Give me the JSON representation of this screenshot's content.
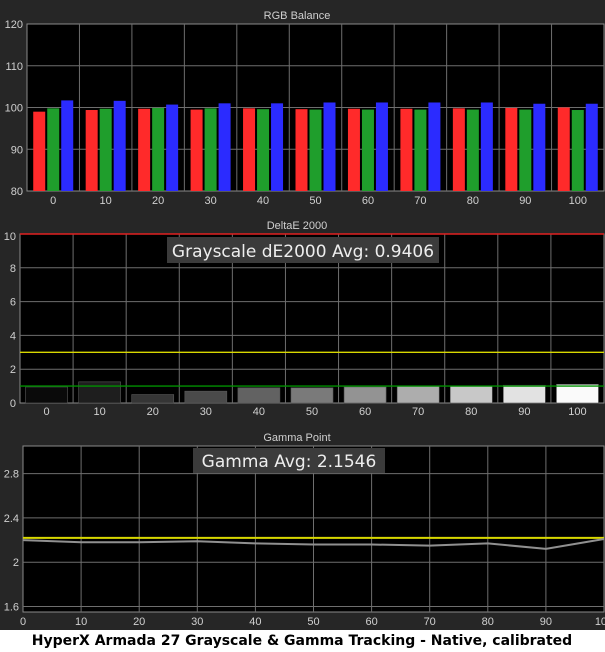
{
  "caption": "HyperX Armada 27 Grayscale & Gamma Tracking - Native, calibrated",
  "colors": {
    "background": "#262626",
    "plot": "#000000",
    "grid": "#6e6e6e",
    "text": "#d0d0d0",
    "red": "#ff2a2a",
    "green": "#1f9e2c",
    "blue": "#2b2bff",
    "yellow": "#d8d800",
    "limit_red": "#e02020",
    "limit_green": "#009000",
    "gamma_line": "#909090"
  },
  "chart_data": [
    {
      "type": "bar",
      "title": "RGB Balance",
      "categories": [
        "0",
        "10",
        "20",
        "30",
        "40",
        "50",
        "60",
        "70",
        "80",
        "90",
        "100"
      ],
      "ylim": [
        80,
        120
      ],
      "yticks": [
        80,
        90,
        100,
        110,
        120
      ],
      "grid": true,
      "series": [
        {
          "color": "red",
          "values": [
            99.0,
            99.4,
            99.7,
            99.5,
            99.8,
            99.6,
            99.7,
            99.7,
            99.8,
            99.9,
            100.0
          ]
        },
        {
          "color": "green",
          "values": [
            99.8,
            99.7,
            99.9,
            99.8,
            99.6,
            99.5,
            99.5,
            99.5,
            99.5,
            99.5,
            99.4
          ]
        },
        {
          "color": "blue",
          "values": [
            101.7,
            101.6,
            100.7,
            101.0,
            101.0,
            101.2,
            101.2,
            101.2,
            101.2,
            100.9,
            100.9
          ]
        }
      ]
    },
    {
      "type": "bar",
      "title": "DeltaE 2000",
      "annotation": "Grayscale dE2000 Avg: 0.9406",
      "categories": [
        "0",
        "10",
        "20",
        "30",
        "40",
        "50",
        "60",
        "70",
        "80",
        "90",
        "100"
      ],
      "values": [
        0.95,
        1.25,
        0.5,
        0.7,
        0.9,
        0.9,
        0.95,
        1.0,
        1.0,
        1.05,
        1.1
      ],
      "bar_colors": [
        "#0a0a0a",
        "#1e1e1e",
        "#353535",
        "#4a4a4a",
        "#626262",
        "#7a7a7a",
        "#939393",
        "#adadad",
        "#c8c8c8",
        "#e2e2e2",
        "#fafafa"
      ],
      "ylim": [
        0,
        10
      ],
      "yticks": [
        0,
        2,
        4,
        6,
        8,
        10
      ],
      "thresholds": [
        {
          "value": 10,
          "color": "limit_red"
        },
        {
          "value": 3,
          "color": "yellow"
        },
        {
          "value": 1,
          "color": "limit_green"
        }
      ],
      "grid": true
    },
    {
      "type": "line",
      "title": "Gamma Point",
      "annotation": "Gamma Avg: 2.1546",
      "x": [
        0,
        10,
        20,
        30,
        40,
        50,
        60,
        70,
        80,
        90,
        100
      ],
      "values": [
        2.2,
        2.18,
        2.18,
        2.19,
        2.17,
        2.16,
        2.16,
        2.15,
        2.17,
        2.12,
        2.21
      ],
      "target": 2.22,
      "xlim": [
        0,
        100
      ],
      "ylim": [
        1.55,
        3.05
      ],
      "yticks": [
        1.6,
        2.0,
        2.4,
        2.8
      ],
      "ytick_labels": [
        "1.6",
        "2",
        "2.4",
        "2.8"
      ],
      "xticks": [
        0,
        10,
        20,
        30,
        40,
        50,
        60,
        70,
        80,
        90,
        100
      ],
      "grid": true
    }
  ]
}
